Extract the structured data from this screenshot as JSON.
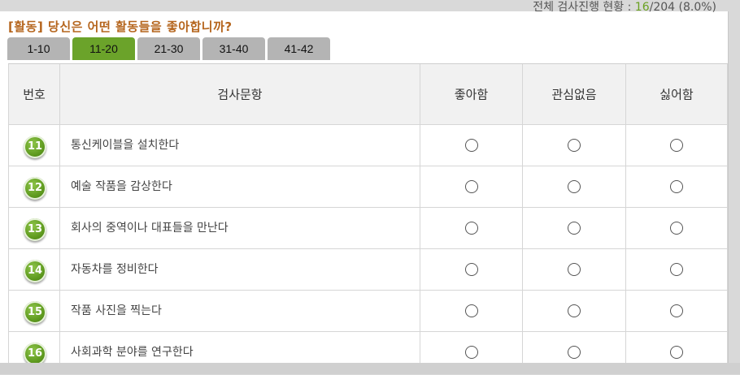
{
  "progress": {
    "prefix": "전체 검사진행 현황 : ",
    "done": "16",
    "rest": "/204 (8.0%)"
  },
  "title": "[활동] 당신은 어떤 활동들을 좋아합니까?",
  "tabs": [
    "1-10",
    "11-20",
    "21-30",
    "31-40",
    "41-42"
  ],
  "active_tab": "11-20",
  "headers": {
    "no": "번호",
    "question": "검사문항",
    "like": "좋아함",
    "neutral": "관심없음",
    "dislike": "싫어함"
  },
  "questions": [
    {
      "no": "11",
      "text": "통신케이블을 설치한다"
    },
    {
      "no": "12",
      "text": "예술 작품을 감상한다"
    },
    {
      "no": "13",
      "text": "회사의 중역이나 대표들을 만난다"
    },
    {
      "no": "14",
      "text": "자동차를 정비한다"
    },
    {
      "no": "15",
      "text": "작품 사진을 찍는다"
    },
    {
      "no": "16",
      "text": "사회과학 분야를 연구한다"
    }
  ],
  "colors": {
    "accent": "#6ba32a",
    "title": "#b5651d",
    "tab": "#b4b4b4"
  }
}
